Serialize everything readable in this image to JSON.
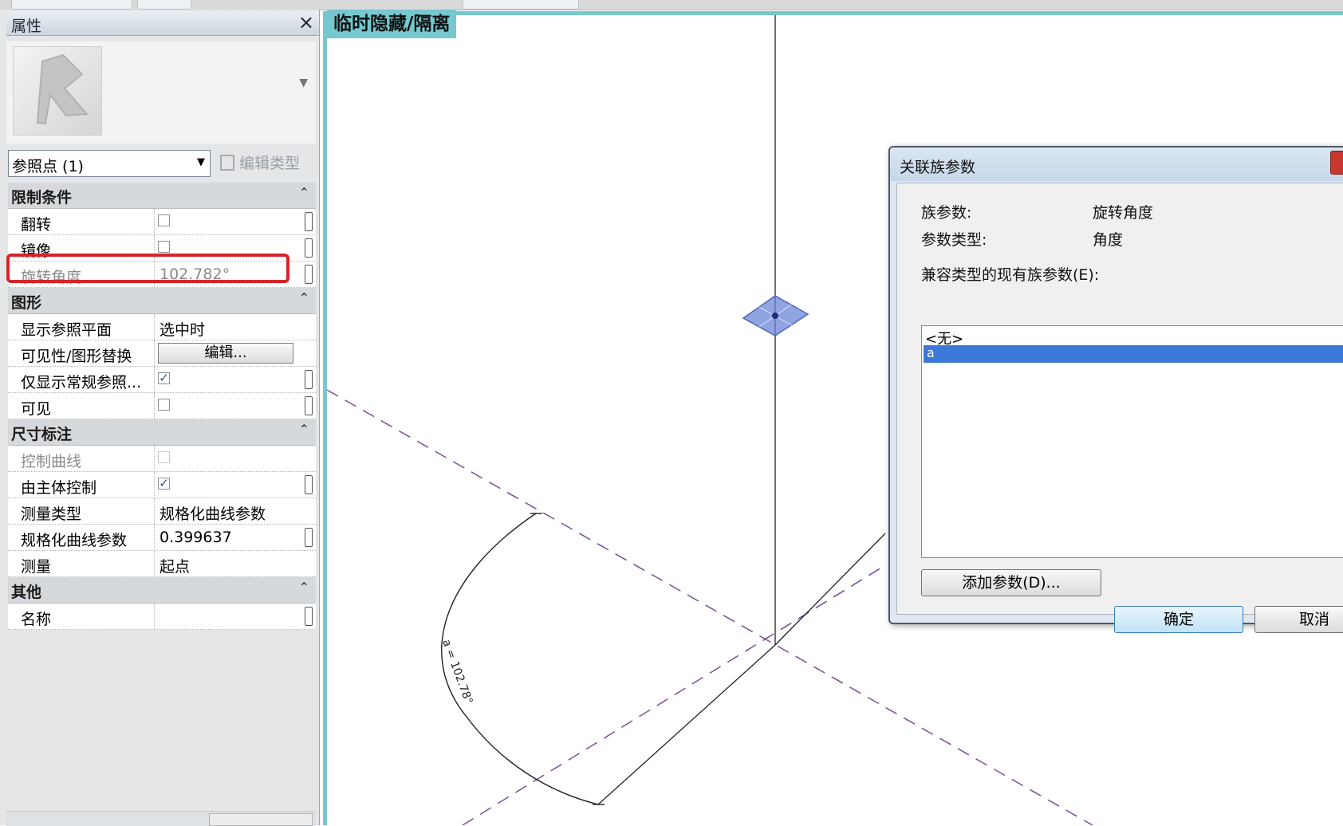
{
  "properties": {
    "title": "属性",
    "close_glyph": "×",
    "type_selector": "参照点 (1)",
    "edit_type_label": "编辑类型",
    "sections": {
      "constraints": "限制条件",
      "graphics": "图形",
      "dimensions": "尺寸标注",
      "other": "其他"
    },
    "collapse_glyph": "⌃",
    "rows": {
      "flip": "翻转",
      "mirror": "镜像",
      "rotation_angle": "旋转角度",
      "rotation_angle_value": "102.782°",
      "show_ref_planes": "显示参照平面",
      "show_ref_planes_value": "选中时",
      "visibility_override": "可见性/图形替换",
      "visibility_edit_btn": "编辑...",
      "show_normal_ref": "仅显示常规参照...",
      "visible": "可见",
      "control_curve": "控制曲线",
      "host_driven": "由主体控制",
      "measure_type": "测量类型",
      "measure_type_value": "规格化曲线参数",
      "normalized_param": "规格化曲线参数",
      "normalized_param_value": "0.399637",
      "measure": "测量",
      "measure_value": "起点",
      "name": "名称",
      "name_value": ""
    },
    "checked_glyph": "✓"
  },
  "view": {
    "label": "临时隐藏/隔离",
    "dimension_label": "a = 102.78°"
  },
  "dialog": {
    "title": "关联族参数",
    "family_param_label": "族参数:",
    "family_param_value": "旋转角度",
    "param_type_label": "参数类型:",
    "param_type_value": "角度",
    "existing_label": "兼容类型的现有族参数(E):",
    "list_items": [
      "<无>",
      "a"
    ],
    "selected_index": 1,
    "add_param_btn": "添加参数(D)...",
    "ok_btn": "确定",
    "cancel_btn": "取消"
  },
  "colors": {
    "view_border": "#76c8cf",
    "highlight": "#d6232a",
    "selection": "#3b78d8",
    "ref_plane_dash": "#7b4d9a",
    "ref_point": "#6b86d8"
  }
}
